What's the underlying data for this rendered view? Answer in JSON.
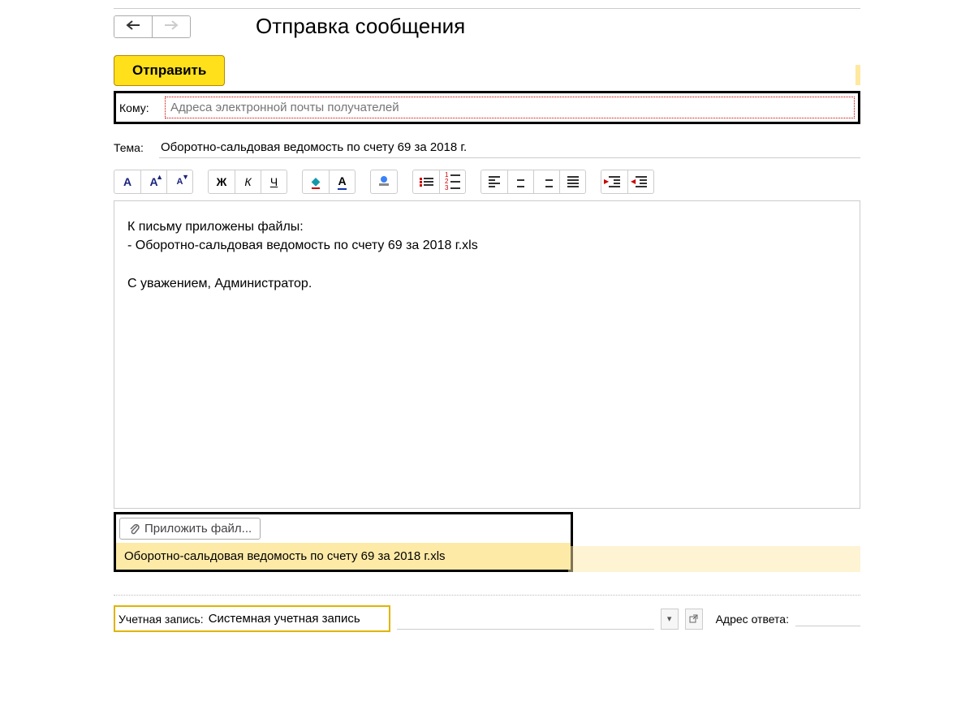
{
  "title": "Отправка сообщения",
  "actions": {
    "send": "Отправить"
  },
  "fields": {
    "to_label": "Кому:",
    "to_placeholder": "Адреса электронной почты получателей",
    "subject_label": "Тема:",
    "subject_value": "Оборотно-сальдовая ведомость по счету 69 за 2018 г."
  },
  "body": "К письму приложены файлы:\n- Оборотно-сальдовая ведомость по счету 69 за 2018 г.xls\n\nС уважением, Администратор.",
  "attach": {
    "button": "Приложить файл...",
    "items": [
      "Оборотно-сальдовая ведомость по счету 69 за 2018 г.xls"
    ]
  },
  "account": {
    "label": "Учетная запись:",
    "value": "Системная учетная запись",
    "reply_label": "Адрес ответа:"
  },
  "toolbar": {
    "bold": "Ж",
    "italic": "К",
    "underline": "Ч"
  }
}
